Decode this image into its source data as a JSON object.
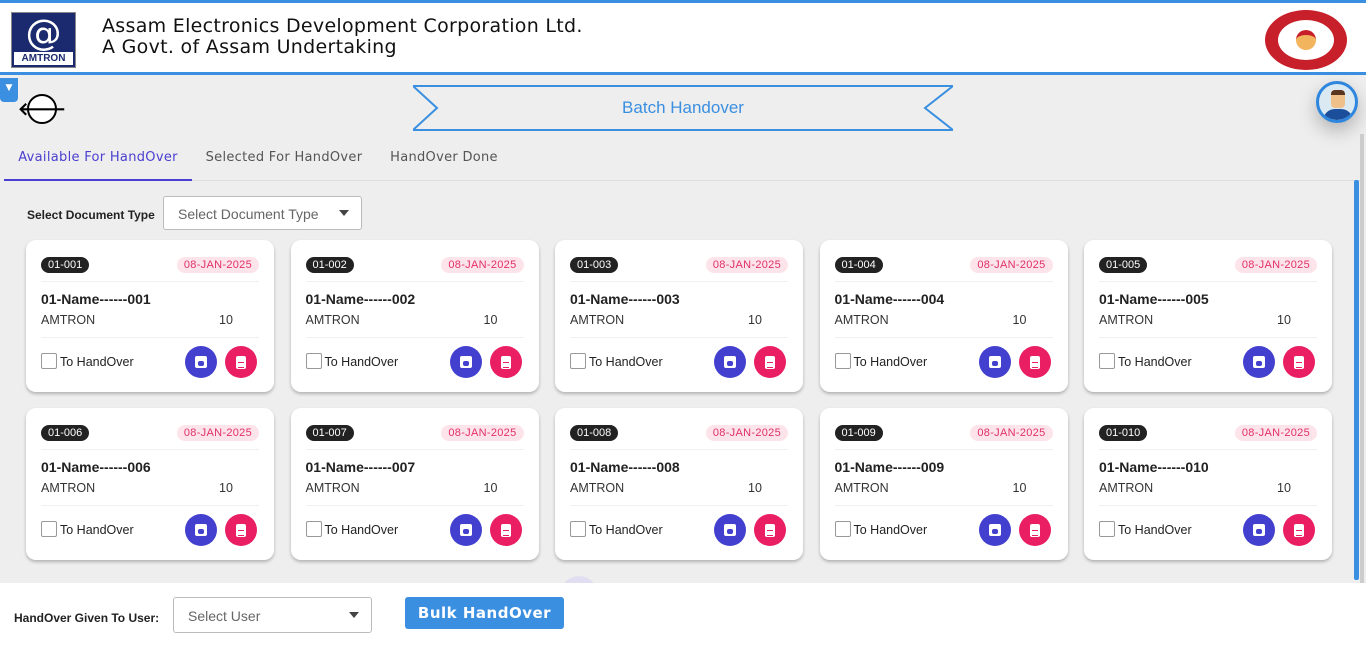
{
  "header": {
    "logo_text": "AMTRON",
    "org_line1": "Assam Electronics Development Corporation Ltd.",
    "org_line2": "A Govt. of Assam Undertaking"
  },
  "page": {
    "title": "Batch Handover"
  },
  "tabs": [
    {
      "label": "Available For HandOver",
      "active": true
    },
    {
      "label": "Selected For HandOver"
    },
    {
      "label": "HandOver Done"
    }
  ],
  "filter": {
    "label": "Select Document Type",
    "placeholder": "Select Document Type"
  },
  "cards": [
    {
      "code": "01-001",
      "date": "08-JAN-2025",
      "name": "01-Name------001",
      "org": "AMTRON",
      "qty": "10",
      "checkbox_label": "To HandOver"
    },
    {
      "code": "01-002",
      "date": "08-JAN-2025",
      "name": "01-Name------002",
      "org": "AMTRON",
      "qty": "10",
      "checkbox_label": "To HandOver"
    },
    {
      "code": "01-003",
      "date": "08-JAN-2025",
      "name": "01-Name------003",
      "org": "AMTRON",
      "qty": "10",
      "checkbox_label": "To HandOver"
    },
    {
      "code": "01-004",
      "date": "08-JAN-2025",
      "name": "01-Name------004",
      "org": "AMTRON",
      "qty": "10",
      "checkbox_label": "To HandOver"
    },
    {
      "code": "01-005",
      "date": "08-JAN-2025",
      "name": "01-Name------005",
      "org": "AMTRON",
      "qty": "10",
      "checkbox_label": "To HandOver"
    },
    {
      "code": "01-006",
      "date": "08-JAN-2025",
      "name": "01-Name------006",
      "org": "AMTRON",
      "qty": "10",
      "checkbox_label": "To HandOver"
    },
    {
      "code": "01-007",
      "date": "08-JAN-2025",
      "name": "01-Name------007",
      "org": "AMTRON",
      "qty": "10",
      "checkbox_label": "To HandOver"
    },
    {
      "code": "01-008",
      "date": "08-JAN-2025",
      "name": "01-Name------008",
      "org": "AMTRON",
      "qty": "10",
      "checkbox_label": "To HandOver"
    },
    {
      "code": "01-009",
      "date": "08-JAN-2025",
      "name": "01-Name------009",
      "org": "AMTRON",
      "qty": "10",
      "checkbox_label": "To HandOver"
    },
    {
      "code": "01-010",
      "date": "08-JAN-2025",
      "name": "01-Name------010",
      "org": "AMTRON",
      "qty": "10",
      "checkbox_label": "To HandOver"
    }
  ],
  "footer": {
    "user_label": "HandOver Given To User:",
    "user_placeholder": "Select User",
    "bulk_button": "Bulk HandOver"
  },
  "colors": {
    "accent": "#3a8fe0",
    "tab_active": "#4a3fd0",
    "save": "#4340cf",
    "doc": "#e91e63"
  }
}
